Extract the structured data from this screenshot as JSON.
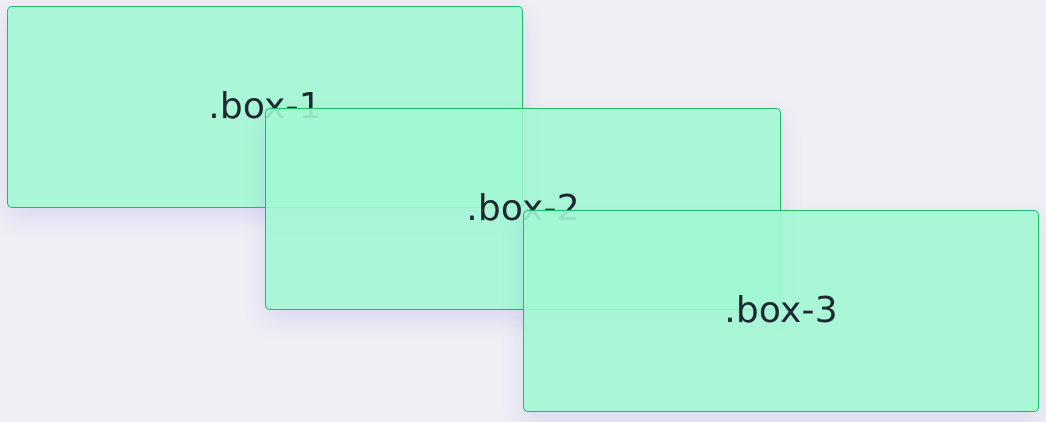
{
  "boxes": [
    {
      "label": ".box-1"
    },
    {
      "label": ".box-2"
    },
    {
      "label": ".box-3"
    }
  ],
  "colors": {
    "page_background": "#efeef5",
    "box_fill": "#a1f7d3",
    "box_border": "#1fbb6a",
    "text": "#1f2733"
  }
}
